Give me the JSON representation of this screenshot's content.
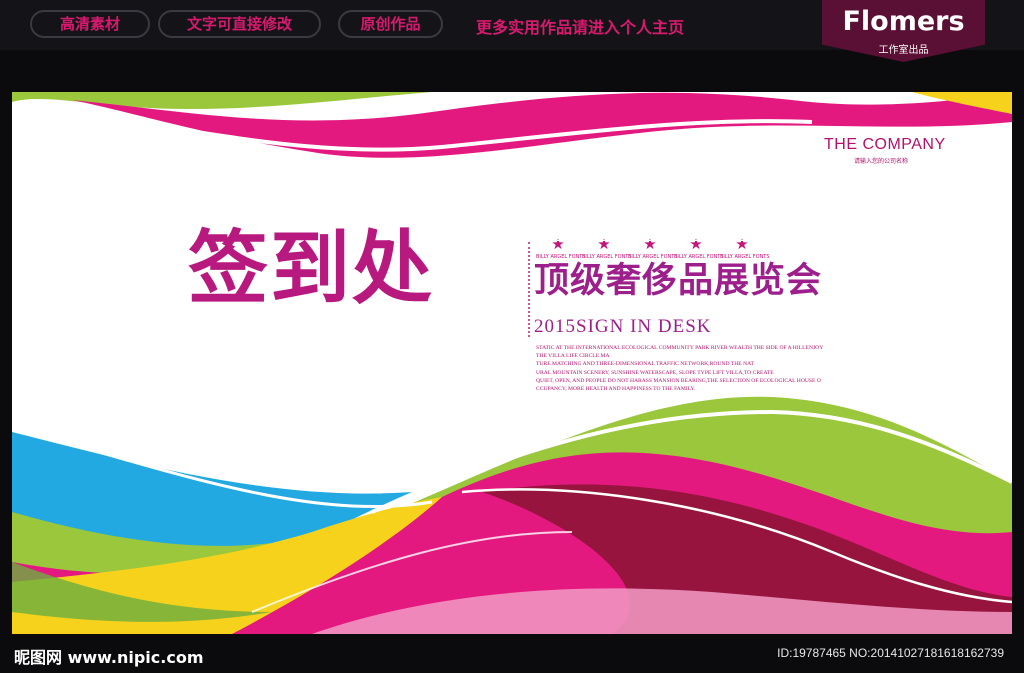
{
  "topbar": {
    "tags": [
      "高清素材",
      "文字可直接修改",
      "原创作品"
    ],
    "more_text": "更多实用作品请进入个人主页"
  },
  "badge": {
    "name": "Flomers",
    "sub": "工作室出品"
  },
  "banner": {
    "company": "THE COMPANY",
    "company_sub": "请输入您的公司名称",
    "title_big": "签到处",
    "stars": {
      "letter": "A",
      "font_label": "BILLY ARGEL FONTS",
      "count": 5
    },
    "subtitle": "顶级奢侈品展览会",
    "sign": "2015SIGN IN DESK",
    "paragraph": [
      "STATIC AT THE INTERNATIONAL ECOLOGICAL COMMUNITY PARK RIVER WEALTH THE SIDE OF A HILLENJOY",
      "THE VILLA LIFE CIRCLE MA",
      "TURE MATCHING AND THREE-DIMENSIONAL TRAFFIC NETWORK,ROUND THE NAT",
      "URAL MOUNTAIN SCENERY, SUNSHINE WATERSCAPE, SLOPE TYPE LIFT VILLA,TO CREATE",
      "QUIET, OPEN, AND PEOPLE DO NOT HARASS MANSION BEARING,THE SELECTION OF ECOLOGICAL HOUSE O",
      "CCUPANCY, MORE HEALTH AND HAPPINESS TO THE FAMILY."
    ]
  },
  "footer": {
    "site": "昵图网 www.nipic.com",
    "id_text": "ID:19787465 NO:20141027181618162739"
  },
  "colors": {
    "magenta": "#e4197f",
    "green": "#9bc73c",
    "yellow": "#f6d21c",
    "cyan": "#22a9e1",
    "purple": "#9c1f8b",
    "dark_red": "#8a1434"
  }
}
